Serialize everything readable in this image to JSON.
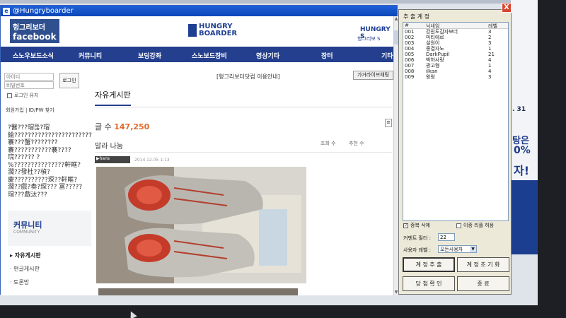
{
  "window": {
    "title": "@Hungryboarder"
  },
  "header": {
    "fb_line1": "헝그리보더",
    "fb_line2": "facebook",
    "logo_line1": "HUNGRY",
    "logo_line2": "BOARDER",
    "right_logo": "HUNGRY S",
    "right_sub": "헝그리보 S"
  },
  "nav": {
    "items": [
      "스노우보드소식",
      "커뮤니티",
      "보딩강좌",
      "스노보드장비",
      "영상기타",
      "장터",
      "기타"
    ]
  },
  "login": {
    "id_placeholder": "아이디",
    "pw_placeholder": "비밀번호",
    "login_button": "로그인",
    "keep_login": "로그인 유지",
    "join": "회원가입",
    "find": "ID/PW 찾기"
  },
  "garbled_text": "?醫???瑁뜮?瑁 鍮??????????????????????? 褰???蟹???????? 褰???????????褰???? 琓?????? ?%???????????????軒眶? 濶??發杜??楨? 慶??????????琛??軒眶? 濶??戲?奏?琛??? 冨?????瑁???戲汰???",
  "sidebar": {
    "community_title": "커뮤니티",
    "community_sub": "COMMUNITY",
    "menu": [
      "▸ 자유게시판",
      "· 편글게시판",
      "· 토론방"
    ]
  },
  "content": {
    "notice_link": "[헝그리보더닷컴 이용안내]",
    "beg_button": "가거라이브채팅",
    "board_tab": "자유게시판",
    "post_count_label": "글 수 ",
    "post_count_value": "147,250",
    "post_title": "말라 나눔",
    "views_label": "조회 수",
    "likes_label": "추천 수",
    "author": "▶hans",
    "date": "2014.12.05 1:13",
    "url": "http://www.hungryboarder.com/index.php?document_srl=..."
  },
  "tool": {
    "title": "추 출 계 정",
    "close": "X",
    "columns": [
      "#",
      "닉네임",
      "레벨"
    ],
    "rows": [
      {
        "id": "001",
        "nick": "강원도감자보더",
        "level": "3"
      },
      {
        "id": "002",
        "nick": "마티에르",
        "level": "2"
      },
      {
        "id": "003",
        "nick": "설원이",
        "level": "3"
      },
      {
        "id": "004",
        "nick": "종결자노",
        "level": "1"
      },
      {
        "id": "005",
        "nick": "DarkPupil",
        "level": "21"
      },
      {
        "id": "006",
        "nick": "박하사랑",
        "level": "4"
      },
      {
        "id": "007",
        "nick": "광고형",
        "level": "1"
      },
      {
        "id": "008",
        "nick": "ilkan",
        "level": "4"
      },
      {
        "id": "009",
        "nick": "왕왕",
        "level": "3"
      }
    ],
    "dup_label": "중복 삭제",
    "dup_checked": true,
    "emoticon_label": "이중 리플 허용",
    "filter_label": "커멘트 필터 :",
    "filter_value": "22",
    "level_label": "사용자 레벨 :",
    "level_value": "모든사용자",
    "btn_extract": "계 정 추 출",
    "btn_reset": "계 정 초 기 화",
    "btn_winner": "당 첨 확 인",
    "btn_exit": "종 료"
  },
  "ad": {
    "date": ". 31",
    "line1": "탕은",
    "line2": "0%",
    "line3": "자!"
  }
}
